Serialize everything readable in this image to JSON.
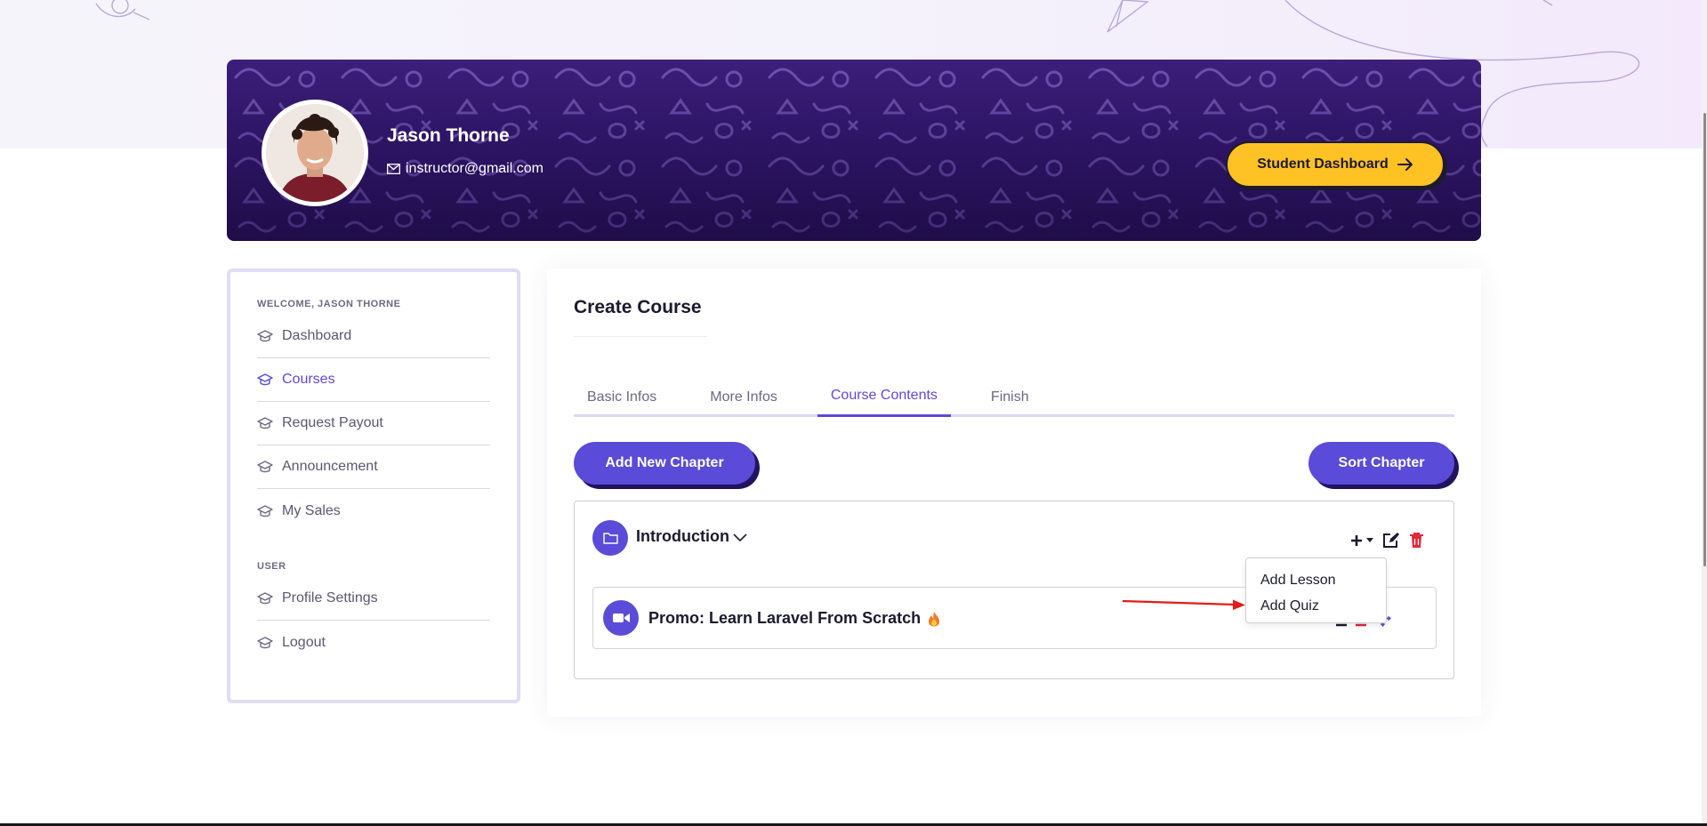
{
  "profile": {
    "name": "Jason Thorne",
    "email": "instructor@gmail.com",
    "dashboard_button": "Student Dashboard"
  },
  "sidebar": {
    "welcome_heading": "WELCOME, JASON THORNE",
    "items": [
      {
        "label": "Dashboard",
        "active": false
      },
      {
        "label": "Courses",
        "active": true
      },
      {
        "label": "Request Payout",
        "active": false
      },
      {
        "label": "Announcement",
        "active": false
      },
      {
        "label": "My Sales",
        "active": false
      }
    ],
    "user_heading": "USER",
    "user_items": [
      {
        "label": "Profile Settings"
      },
      {
        "label": "Logout"
      }
    ]
  },
  "main": {
    "title": "Create Course",
    "tabs": [
      {
        "label": "Basic Infos",
        "active": false
      },
      {
        "label": "More Infos",
        "active": false
      },
      {
        "label": "Course Contents",
        "active": true
      },
      {
        "label": "Finish",
        "active": false
      }
    ],
    "add_chapter_button": "Add New Chapter",
    "sort_chapter_button": "Sort Chapter",
    "chapter": {
      "title": "Introduction",
      "lesson": {
        "title": "Promo: Learn Laravel From Scratch"
      }
    },
    "add_menu": {
      "items": [
        "Add Lesson",
        "Add Quiz"
      ]
    }
  },
  "colors": {
    "accent": "#5a4bd8",
    "accent_shadow": "#21135f",
    "banner": "#2f1566",
    "cta_yellow": "#ffc224",
    "danger": "#e0283a",
    "annotation_arrow": "#e41b1b"
  },
  "icons": {
    "sidebar": "graduation-cap-icon",
    "email": "envelope-icon",
    "arrow": "arrow-right-icon",
    "chapter": "folder-icon",
    "lesson": "video-camera-icon",
    "lesson_badge": "fire-icon",
    "add": "plus-icon",
    "edit": "edit-icon",
    "delete": "trash-icon",
    "move": "move-arrows-icon"
  }
}
